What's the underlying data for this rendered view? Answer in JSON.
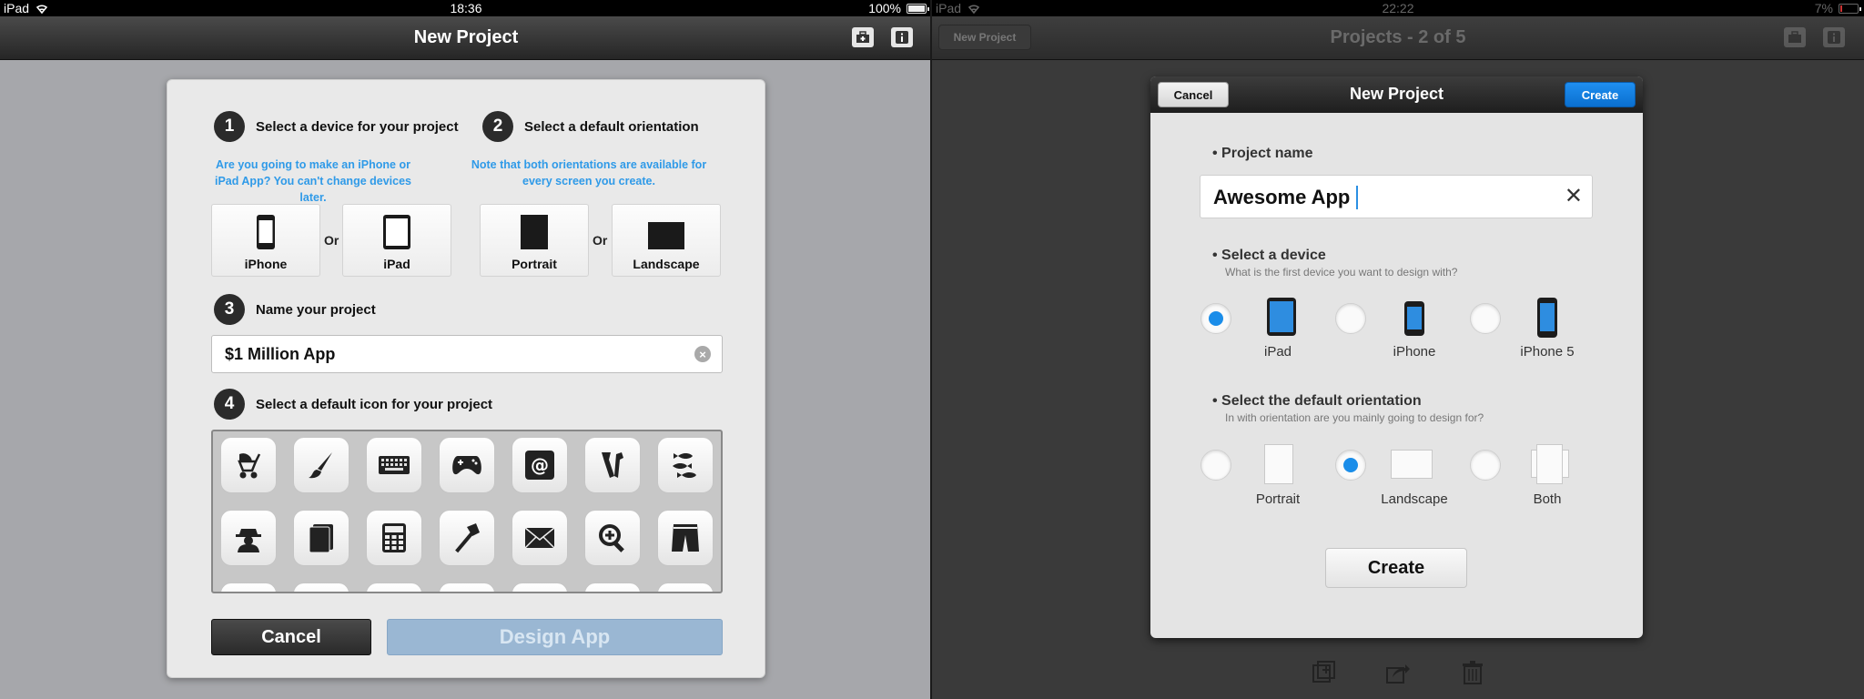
{
  "left": {
    "status": {
      "device": "iPad",
      "time": "18:36",
      "battery": "100%",
      "battery_fill": 1.0
    },
    "nav": {
      "title": "New Project"
    },
    "steps": [
      {
        "num": "1",
        "label": "Select a device for your project"
      },
      {
        "num": "2",
        "label": "Select a default orientation"
      },
      {
        "num": "3",
        "label": "Name your project"
      },
      {
        "num": "4",
        "label": "Select a default icon for your project"
      }
    ],
    "hints": {
      "device_line1": "Are you going to make an iPhone or",
      "device_line2": "iPad App? You can't change devices later.",
      "orientation_line1": "Note that both orientations are available for",
      "orientation_line2": "every screen you create."
    },
    "device_tiles": {
      "iphone": "iPhone",
      "ipad": "iPad",
      "or": "Or"
    },
    "orientation_tiles": {
      "portrait": "Portrait",
      "landscape": "Landscape",
      "or": "Or"
    },
    "project_name": "$1 Million App",
    "icons": [
      "stroller-icon",
      "paintbrush-icon",
      "keyboard-icon",
      "gamepad-icon",
      "at-sign-icon",
      "tools-icon",
      "fish-icon",
      "spy-icon",
      "book-icon",
      "calculator-icon",
      "axe-icon",
      "mail-icon",
      "zoom-in-icon",
      "shorts-icon"
    ],
    "buttons": {
      "cancel": "Cancel",
      "design": "Design App"
    }
  },
  "right": {
    "status": {
      "device": "iPad",
      "time": "22:22",
      "battery": "7%",
      "battery_fill": 0.07
    },
    "nav": {
      "title": "Projects - 2 of 5",
      "left_button": "New Project"
    },
    "dialog": {
      "title": "New Project",
      "cancel": "Cancel",
      "create": "Create",
      "project_name_title": "• Project name",
      "project_name_value": "Awesome App",
      "device_title": "• Select a device",
      "device_sub": "What is the first device you want to design with?",
      "devices": [
        {
          "label": "iPad",
          "selected": true
        },
        {
          "label": "iPhone",
          "selected": false
        },
        {
          "label": "iPhone 5",
          "selected": false
        }
      ],
      "orientation_title": "• Select the default orientation",
      "orientation_sub": "In with orientation are you mainly going to design for?",
      "orientations": [
        {
          "label": "Portrait",
          "selected": false
        },
        {
          "label": "Landscape",
          "selected": true
        },
        {
          "label": "Both",
          "selected": false
        }
      ],
      "create_big": "Create"
    }
  }
}
